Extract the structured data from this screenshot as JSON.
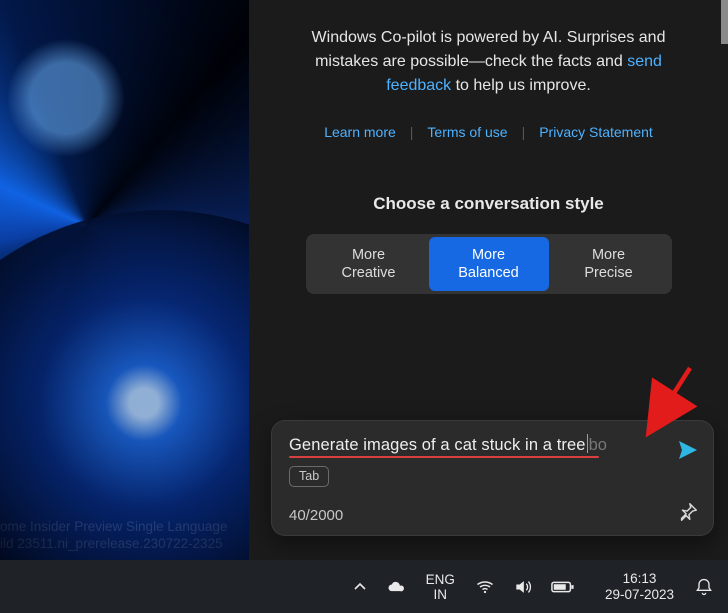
{
  "desktop": {
    "watermark_line1": "ome Insider Preview Single Language",
    "watermark_line2": "ild 23511.ni_prerelease.230722-2325"
  },
  "copilot": {
    "disclaimer_pre": "Windows Co-pilot is powered by AI. Surprises and mistakes are possible—check the facts and ",
    "disclaimer_link": "send feedback",
    "disclaimer_post": " to help us improve.",
    "links": {
      "learn_more": "Learn more",
      "terms": "Terms of use",
      "privacy": "Privacy Statement"
    },
    "style_heading": "Choose a conversation style",
    "styles": {
      "creative_l1": "More",
      "creative_l2": "Creative",
      "balanced_l1": "More",
      "balanced_l2": "Balanced",
      "precise_l1": "More",
      "precise_l2": "Precise"
    },
    "input": {
      "value": "Generate images of a cat stuck in a tree",
      "placeholder_tail": "bo",
      "tab_hint": "Tab",
      "counter": "40/2000"
    }
  },
  "taskbar": {
    "lang_top": "ENG",
    "lang_bottom": "IN",
    "time": "16:13",
    "date": "29-07-2023"
  }
}
